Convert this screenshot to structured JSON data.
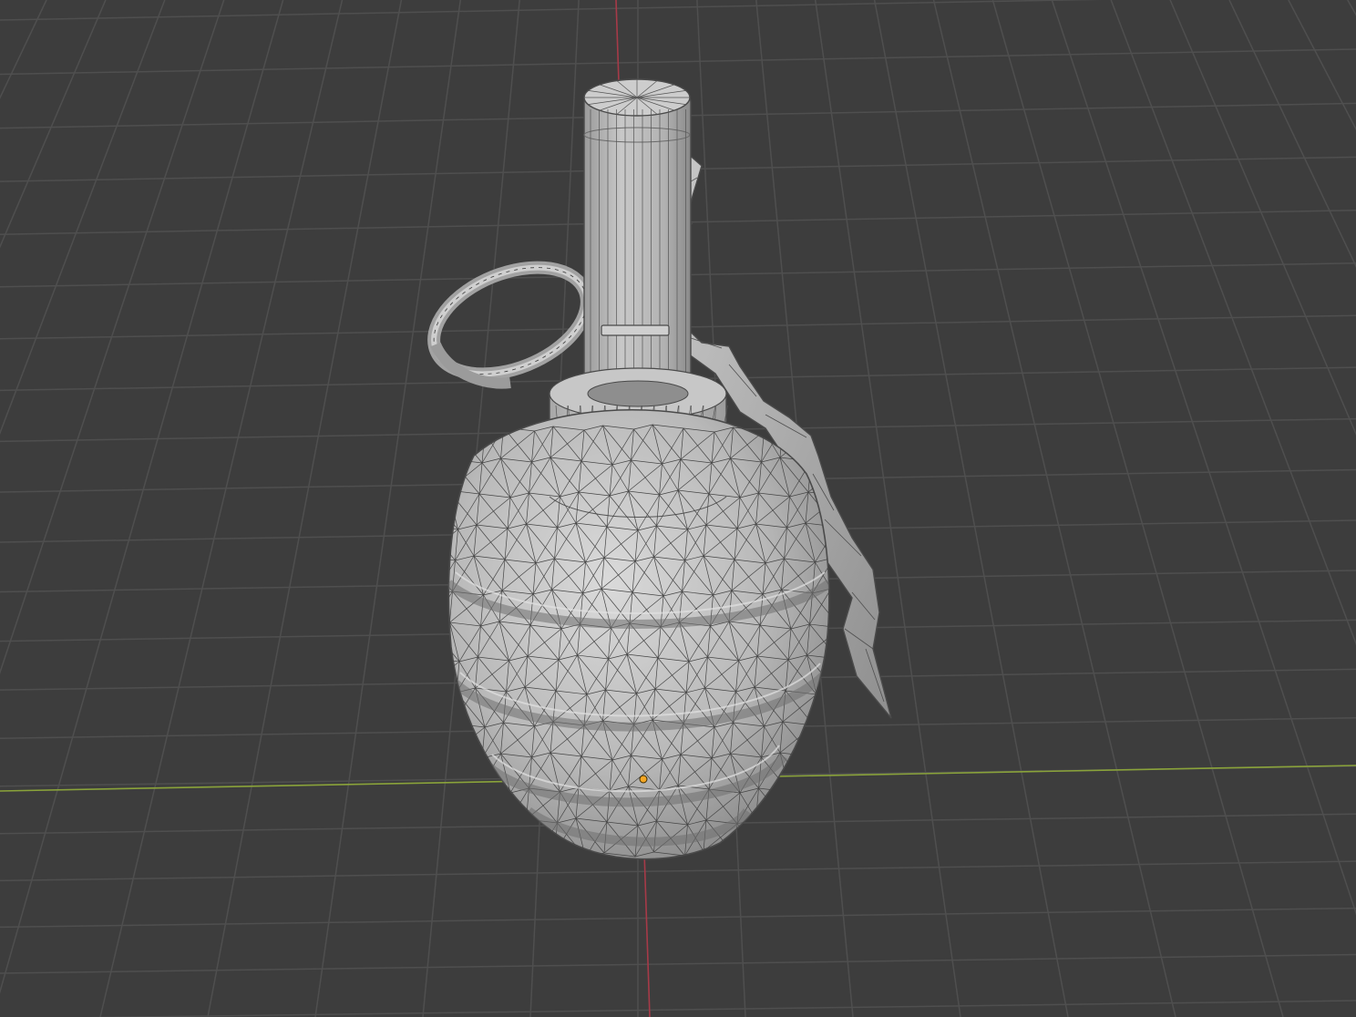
{
  "viewport": {
    "view": "3D Viewport",
    "shading": "solid",
    "overlays": {
      "wireframe": true,
      "floor_grid": true,
      "x_axis": true,
      "y_axis": true
    },
    "colors": {
      "background": "#3d3d3d",
      "grid_line": "#4f4f4f",
      "x_axis": "#8aa33a",
      "y_axis": "#a63a48",
      "mesh_light": "#d2d2d2",
      "mesh_mid": "#a9a9a9",
      "mesh_dark": "#6e6e6e",
      "wire": "#3c3c3c",
      "origin": "#f5a623"
    }
  },
  "object": {
    "type": "mesh",
    "description_icon": "grenade-mesh-icon",
    "parts": [
      "fuse-cap",
      "fuse-tube",
      "safety-lever",
      "pull-ring",
      "body-collar",
      "fragmentation-body"
    ],
    "origin_marker": true
  }
}
